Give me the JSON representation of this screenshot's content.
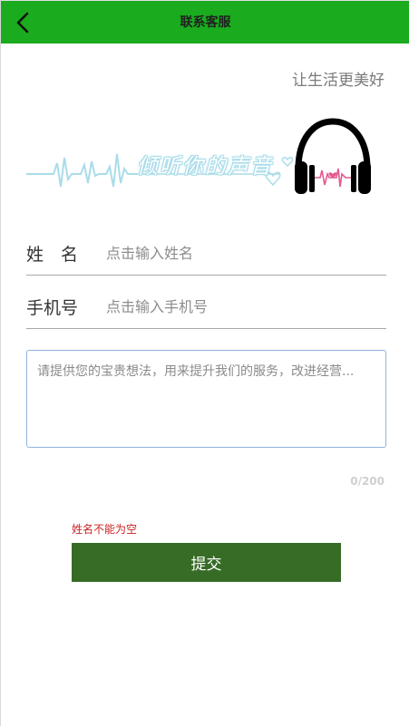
{
  "header": {
    "title": "联系客服",
    "back_icon": "chevron-left-icon",
    "bg_color": "#1aab1f"
  },
  "slogan": "让生活更美好",
  "banner": {
    "text": "倾听你的声音",
    "icon": "headphones-icon"
  },
  "form": {
    "name_label": "姓　名",
    "name_placeholder": "点击输入姓名",
    "phone_label": "手机号",
    "phone_placeholder": "点击输入手机号",
    "feedback_placeholder": "请提供您的宝贵想法，用来提升我们的服务，改进经营...",
    "counter": "0/200",
    "error": "姓名不能为空",
    "submit_label": "提交",
    "submit_color": "#366c26"
  }
}
